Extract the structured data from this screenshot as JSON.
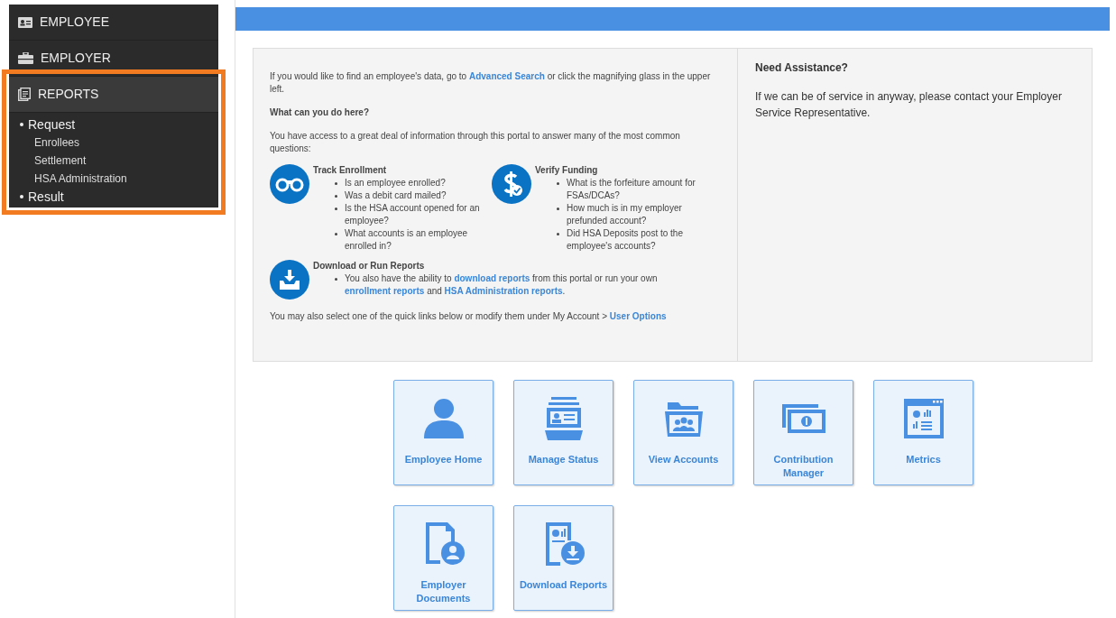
{
  "sidebar": {
    "items": [
      {
        "label": "EMPLOYEE",
        "expanded": false,
        "highlighted": false
      },
      {
        "label": "EMPLOYER",
        "expanded": false,
        "highlighted": false
      },
      {
        "label": "REPORTS",
        "expanded": true,
        "highlighted": true,
        "children": [
          {
            "label": "Request",
            "children": [
              {
                "label": "Enrollees"
              },
              {
                "label": "Settlement"
              },
              {
                "label": "HSA Administration"
              }
            ]
          },
          {
            "label": "Result"
          }
        ]
      }
    ]
  },
  "info": {
    "intro": [
      {
        "text": "If you would like to find an employee's data, go to ",
        "link": false
      },
      {
        "text": "Advanced Search",
        "link": true
      },
      {
        "text": " or click the magnifying glass in the upper left.",
        "link": false
      }
    ],
    "heading": "What can you do here?",
    "access": "You have access to a great deal of information through this portal to answer many of the most common questions:",
    "features": [
      {
        "title": "Track Enrollment",
        "bullets": [
          [
            {
              "text": "Is an employee enrolled?",
              "link": false
            }
          ],
          [
            {
              "text": "Was a debit card mailed?",
              "link": false
            }
          ],
          [
            {
              "text": "Is the HSA account opened for an employee?",
              "link": false
            }
          ],
          [
            {
              "text": "What accounts is an employee enrolled in?",
              "link": false
            }
          ]
        ]
      },
      {
        "title": "Verify Funding",
        "bullets": [
          [
            {
              "text": "What is the forfeiture amount for FSAs/DCAs?",
              "link": false
            }
          ],
          [
            {
              "text": "How much is in my employer prefunded account?",
              "link": false
            }
          ],
          [
            {
              "text": "Did HSA Deposits post to the employee's accounts?",
              "link": false
            }
          ]
        ]
      },
      {
        "title": "Download or Run Reports",
        "bullets": [
          [
            {
              "text": "You also have the ability to ",
              "link": false
            },
            {
              "text": "download reports",
              "link": true
            },
            {
              "text": " from this portal or run your own ",
              "link": false
            },
            {
              "text": "enrollment reports",
              "link": true
            },
            {
              "text": " and ",
              "link": false
            },
            {
              "text": "HSA Administration reports",
              "link": true
            },
            {
              "text": ".",
              "link": false
            }
          ]
        ]
      }
    ],
    "footer": [
      {
        "text": "You may also select one of the quick links below or modify them under My Account > ",
        "link": false
      },
      {
        "text": "User Options",
        "link": true
      }
    ]
  },
  "assistance": {
    "title": "Need Assistance?",
    "text": "If we can be of service in anyway, please contact your Employer Service Representative."
  },
  "quick_links": [
    {
      "label": "Employee Home"
    },
    {
      "label": "Manage Status"
    },
    {
      "label": "View Accounts"
    },
    {
      "label": "Contribution Manager"
    },
    {
      "label": "Metrics"
    },
    {
      "label": "Employer Documents"
    },
    {
      "label": "Download Reports"
    }
  ]
}
